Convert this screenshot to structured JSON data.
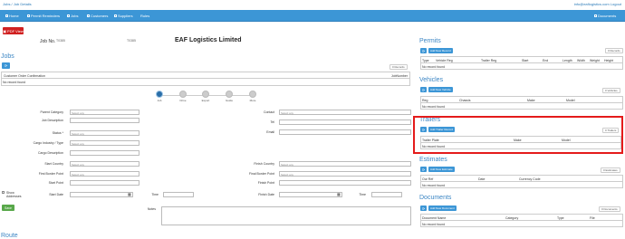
{
  "breadcrumb": "Jobs / Job Details",
  "user": "info@eaflogistics.com  Logout",
  "nav": {
    "left": [
      "Home",
      "Permit Reminders",
      "Jobs",
      "Customers",
      "Suppliers",
      "Rules"
    ],
    "right": "Documents"
  },
  "pdf_label": "PDF View",
  "job": {
    "label": "Job No.",
    "value": "T0385",
    "value2": "T0385",
    "company": "EAF Logistics Limited"
  },
  "jobs": {
    "title": "Jobs",
    "records": "0 Records",
    "col1": "Customer Order Confirmation",
    "col2": "JobNumber",
    "empty": "No record found"
  },
  "steps": [
    "Job",
    "Drive",
    "Export",
    "Guide",
    "More"
  ],
  "form_left": [
    {
      "label": "Parent Category",
      "type": "select",
      "value": "Select any"
    },
    {
      "label": "Job Description",
      "type": "input",
      "value": ""
    },
    {
      "label": "Status *",
      "type": "select",
      "value": "Select any"
    },
    {
      "label": "Cargo Industry / Type",
      "type": "select",
      "value": "Select any"
    },
    {
      "label": "Cargo Description",
      "type": "input",
      "value": ""
    },
    {
      "label": "Start Country",
      "type": "select",
      "value": "Select any"
    },
    {
      "label": "First Border Point",
      "type": "select",
      "value": "Select any"
    },
    {
      "label": "Start Point",
      "type": "input",
      "value": ""
    },
    {
      "label": "Start Date",
      "type": "input",
      "value": ""
    }
  ],
  "form_right": [
    {
      "label": "Contact",
      "value": "Select any"
    },
    {
      "label": "Tel",
      "value": ""
    },
    {
      "label": "Email",
      "value": ""
    },
    {
      "label": "Finish Country",
      "value": "Select any"
    },
    {
      "label": "Final Border Point",
      "value": "Select any"
    },
    {
      "label": "Finish Point",
      "value": ""
    },
    {
      "label": "Finish Date",
      "value": ""
    }
  ],
  "time_label": "Time",
  "show_addresses": "Show Addresses",
  "notes_label": "Notes",
  "save_label": "Save",
  "route_label": "Route",
  "permits": {
    "title": "Permits",
    "add": "Add New Record",
    "records": "0 Records",
    "cols": [
      "Type",
      "Vehicle Reg",
      "Trailer Reg",
      "Start",
      "End",
      "Length",
      "Width",
      "Weight",
      "Height"
    ],
    "empty": "No record found"
  },
  "vehicles": {
    "title": "Vehicles",
    "add": "Add New Vehicle",
    "records": "0 Vehicles",
    "cols": [
      "Reg",
      "Chassis",
      "Make",
      "Model"
    ],
    "empty": "No record found"
  },
  "trailers": {
    "title": "Trailers",
    "add": "Add Trailer Record",
    "records": "0 Trailers",
    "cols": [
      "Trailer Plate",
      "Make",
      "Model"
    ],
    "empty": "No record found"
  },
  "estimates": {
    "title": "Estimates",
    "add": "Add New Estimate",
    "records": "0 Estimates",
    "cols": [
      "Our Ref",
      "Date",
      "Currency Code"
    ],
    "empty": "No record found"
  },
  "documents": {
    "title": "Documents",
    "add": "Add New Document",
    "records": "0 Documents",
    "cols": [
      "Document Name",
      "Category",
      "Type",
      "File"
    ],
    "empty": "No record found"
  },
  "colors": {
    "nav": "#3c96d6",
    "pdf": "#d02020",
    "save": "#58a84a",
    "highlight": "#e41b1b"
  }
}
